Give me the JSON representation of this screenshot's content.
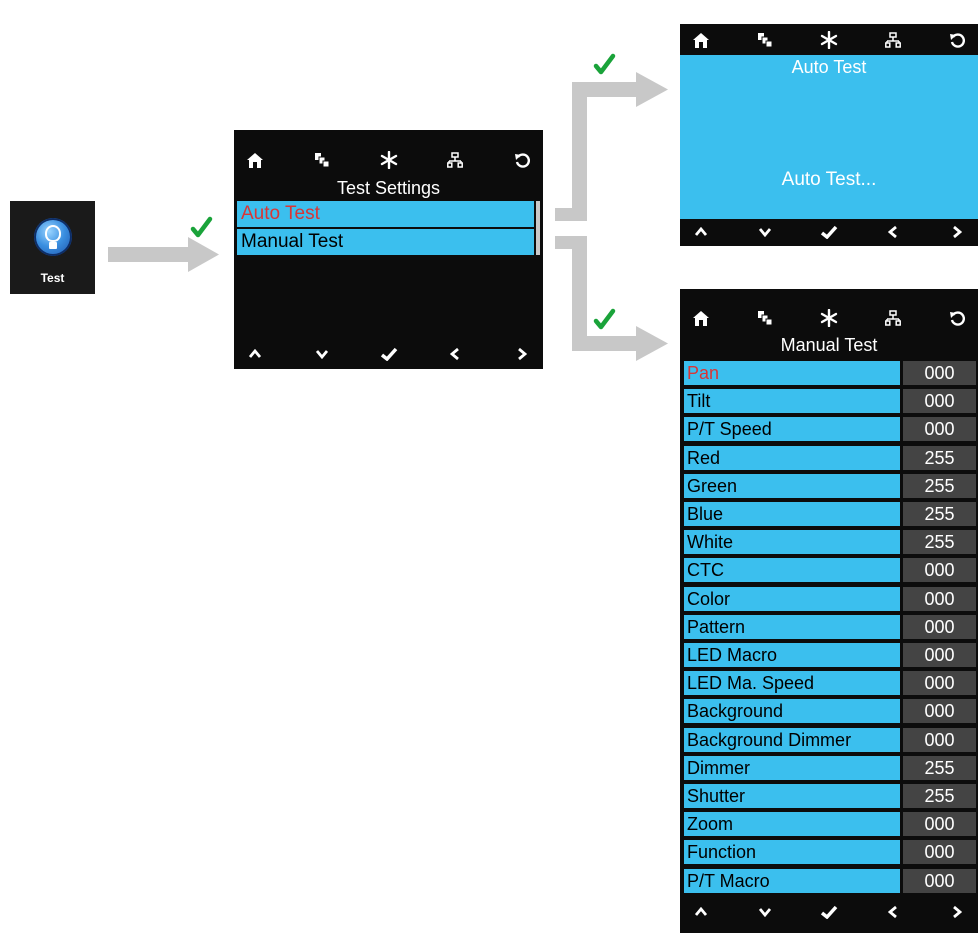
{
  "colors": {
    "accent": "#3bbfee",
    "selected_text": "#d93636",
    "check": "#1aa33a",
    "arrow": "#c8c8c8",
    "value_bg": "#444444"
  },
  "launcher": {
    "label": "Test",
    "icon": "lightbulb-icon"
  },
  "topbar_icons": [
    "home-icon",
    "layers-icon",
    "asterisk-icon",
    "network-icon",
    "refresh-icon"
  ],
  "bottombar_icons": [
    "up-arrow-icon",
    "down-arrow-icon",
    "confirm-check-icon",
    "left-arrow-icon",
    "right-arrow-icon"
  ],
  "test_settings": {
    "title": "Test Settings",
    "items": [
      {
        "label": "Auto Test",
        "selected": true
      },
      {
        "label": "Manual Test",
        "selected": false
      }
    ]
  },
  "auto_test": {
    "title": "Auto Test",
    "status": "Auto Test..."
  },
  "manual_test": {
    "title": "Manual Test",
    "rows": [
      {
        "label": "Pan",
        "value": "000",
        "selected": true
      },
      {
        "label": "Tilt",
        "value": "000"
      },
      {
        "label": "P/T Speed",
        "value": "000"
      },
      {
        "label": "Red",
        "value": "255"
      },
      {
        "label": "Green",
        "value": "255"
      },
      {
        "label": "Blue",
        "value": "255"
      },
      {
        "label": "White",
        "value": "255"
      },
      {
        "label": "CTC",
        "value": "000"
      },
      {
        "label": "Color",
        "value": "000"
      },
      {
        "label": "Pattern",
        "value": "000"
      },
      {
        "label": "LED Macro",
        "value": "000"
      },
      {
        "label": "LED Ma. Speed",
        "value": "000"
      },
      {
        "label": "Background",
        "value": "000"
      },
      {
        "label": "Background Dimmer",
        "value": "000"
      },
      {
        "label": "Dimmer",
        "value": "255"
      },
      {
        "label": "Shutter",
        "value": "255"
      },
      {
        "label": "Zoom",
        "value": "000"
      },
      {
        "label": "Function",
        "value": "000"
      },
      {
        "label": "P/T Macro",
        "value": "000"
      }
    ]
  }
}
